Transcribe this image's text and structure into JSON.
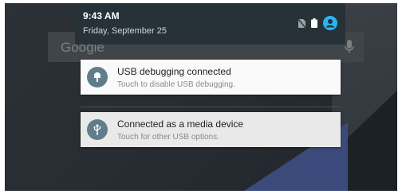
{
  "status_bar": {
    "time": "9:43 AM",
    "date": "Friday, September 25",
    "icons": [
      "no-sim-icon",
      "battery-icon",
      "user-avatar-icon"
    ]
  },
  "search": {
    "brand": "Google",
    "icon": "mic-icon"
  },
  "notifications": [
    {
      "title": "USB debugging connected",
      "text": "Touch to disable USB debugging.",
      "icon": "android-debug-icon"
    },
    {
      "title": "Connected as a media device",
      "text": "Touch for other USB options.",
      "icon": "usb-icon"
    }
  ],
  "colors": {
    "header_bg": "#263238",
    "notif_icon_bg": "#607d8b",
    "avatar_accent": "#29b6f6"
  }
}
